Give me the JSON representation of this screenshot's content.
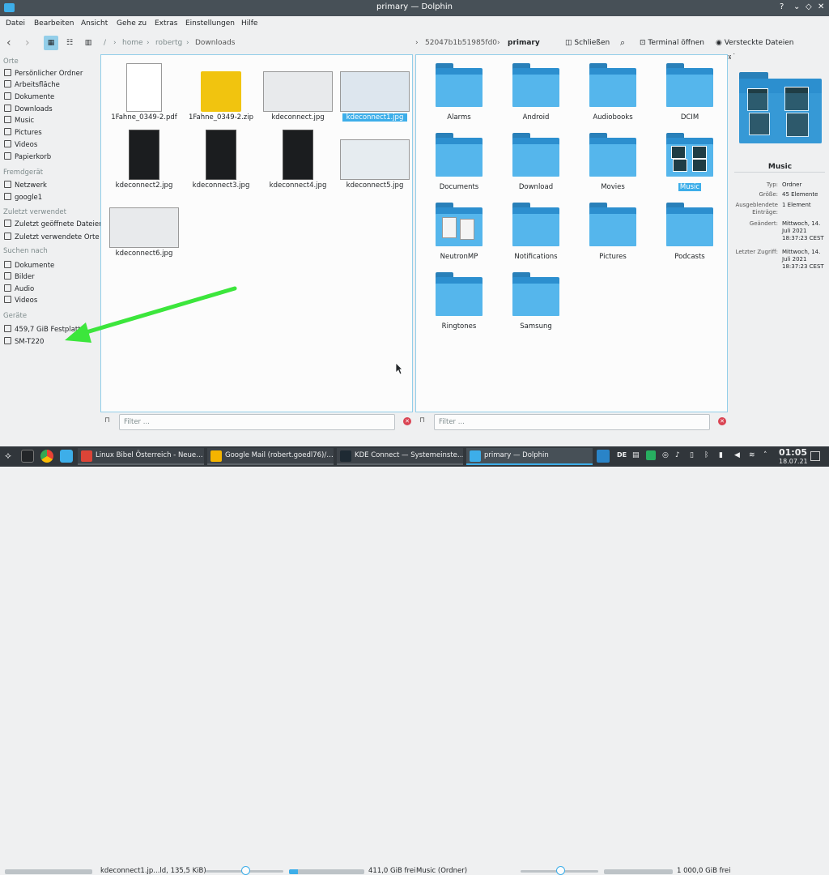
{
  "window": {
    "title": "primary — Dolphin"
  },
  "menu": [
    "Datei",
    "Bearbeiten",
    "Ansicht",
    "Gehe zu",
    "Extras",
    "Einstellungen",
    "Hilfe"
  ],
  "toolbar": {
    "breadcrumb_left": [
      "/",
      "home",
      "robertg",
      "Downloads"
    ],
    "breadcrumb_right": [
      "52047b1b51985fd0",
      "primary"
    ],
    "close_label": "Schließen",
    "terminal_label": "Terminal öffnen",
    "hidden_label": "Versteckte Dateien anzeigen"
  },
  "places": {
    "groups": [
      {
        "title": "Orte",
        "items": [
          "Persönlicher Ordner",
          "Arbeitsfläche",
          "Dokumente",
          "Downloads",
          "Music",
          "Pictures",
          "Videos",
          "Papierkorb"
        ]
      },
      {
        "title": "Fremdgerät",
        "items": [
          "Netzwerk",
          "google1"
        ]
      },
      {
        "title": "Zuletzt verwendet",
        "items": [
          "Zuletzt geöffnete Dateien",
          "Zuletzt verwendete Orte"
        ]
      },
      {
        "title": "Suchen nach",
        "items": [
          "Dokumente",
          "Bilder",
          "Audio",
          "Videos"
        ]
      },
      {
        "title": "Geräte",
        "items": [
          "459,7 GiB Festplatte",
          "SM-T220"
        ]
      }
    ]
  },
  "left_files": [
    "1Fahne_0349-2.pdf",
    "1Fahne_0349-2.zip",
    "kdeconnect.jpg",
    "kdeconnect1.jpg",
    "kdeconnect2.jpg",
    "kdeconnect3.jpg",
    "kdeconnect4.jpg",
    "kdeconnect5.jpg",
    "kdeconnect6.jpg"
  ],
  "right_folders": [
    "Alarms",
    "Android",
    "Audiobooks",
    "DCIM",
    "Documents",
    "Download",
    "Movies",
    "Music",
    "NeutronMP",
    "Notifications",
    "Pictures",
    "Podcasts",
    "Ringtones",
    "Samsung"
  ],
  "info": {
    "name": "Music",
    "rows": [
      {
        "k": "Typ:",
        "v": "Ordner"
      },
      {
        "k": "Größe:",
        "v": "45 Elemente"
      },
      {
        "k": "Ausgeblendete Einträge:",
        "v": "1 Element"
      },
      {
        "k": "Geändert:",
        "v": "Mittwoch, 14. Juli 2021 18:37:23 CEST"
      },
      {
        "k": "Letzter Zugriff:",
        "v": "Mittwoch, 14. Juli 2021 18:37:23 CEST"
      }
    ]
  },
  "filter": {
    "placeholder": "Filter ..."
  },
  "status": {
    "left_text": "kdeconnect1.jp...ld, 135,5 KiB)",
    "left_free": "411,0 GiB frei",
    "left_usage": 0.12,
    "right_text": "Music (Ordner)",
    "right_free": "1 000,0 GiB frei",
    "right_usage": 0.0
  },
  "taskbar": {
    "tasks": [
      "Linux Bibel Österreich - Neue…",
      "Google Mail (robert.goedl76)/…",
      "KDE Connect — Systemeinste…",
      "primary — Dolphin"
    ],
    "lang": "DE",
    "time": "01:05",
    "date": "18.07.21"
  }
}
